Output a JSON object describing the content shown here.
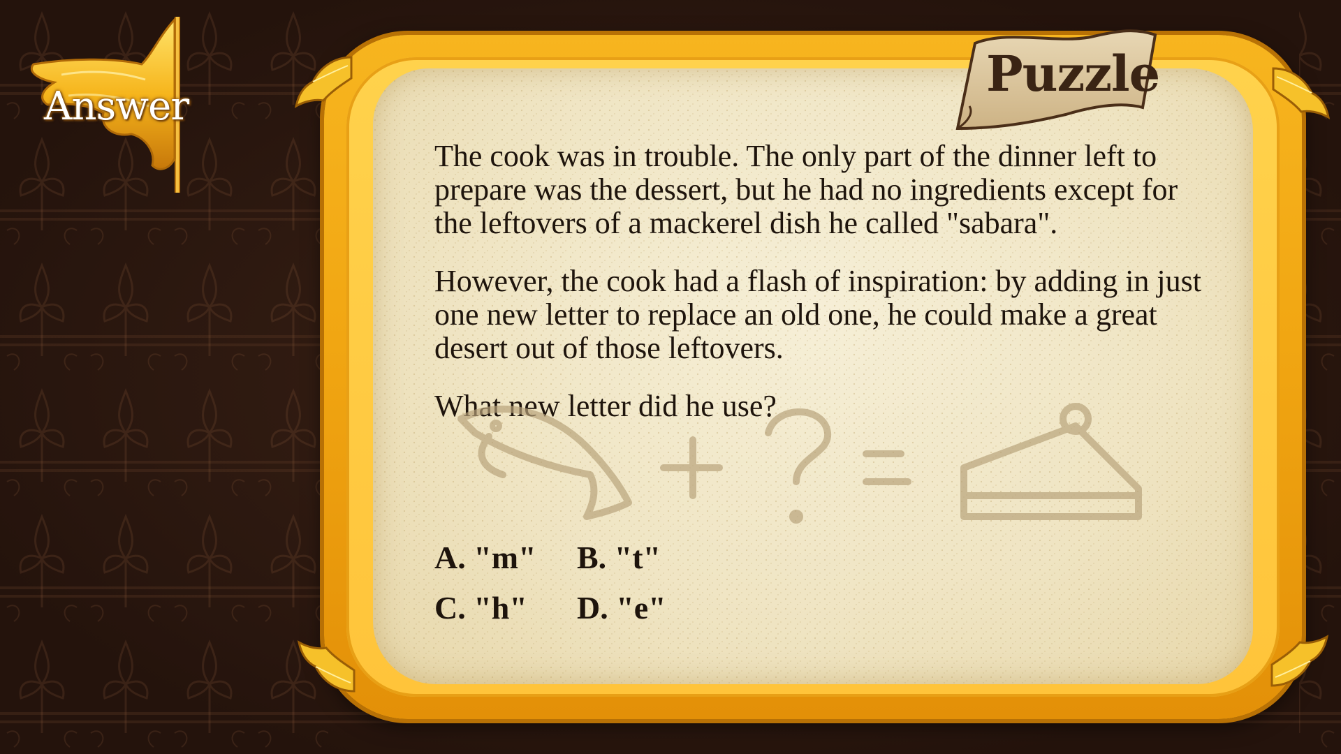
{
  "answer_button": {
    "label": "Answer"
  },
  "puzzle_banner": {
    "label": "Puzzle"
  },
  "question": {
    "paragraphs": [
      "The cook was in trouble. The only part of the dinner left to prepare was the dessert, but he had no ingredients except for the leftovers of a mackerel dish he called \"sabara\".",
      "However, the cook had a flash of inspiration: by adding in just one new letter to replace an old one, he could make a great desert out of those leftovers.",
      "What new letter did he use?"
    ]
  },
  "sketch": {
    "icons": [
      "fish-icon",
      "plus-icon",
      "question-mark-icon",
      "equals-icon",
      "cake-slice-icon"
    ]
  },
  "options": [
    {
      "label": "A. \"m\""
    },
    {
      "label": "B. \"t\""
    },
    {
      "label": "C. \"h\""
    },
    {
      "label": "D. \"e\""
    }
  ],
  "colors": {
    "background": "#2a1710",
    "frame_gold": "#f1a612",
    "paper": "#efe4c2",
    "text": "#1e140c",
    "banner": "#d9c4a0"
  }
}
